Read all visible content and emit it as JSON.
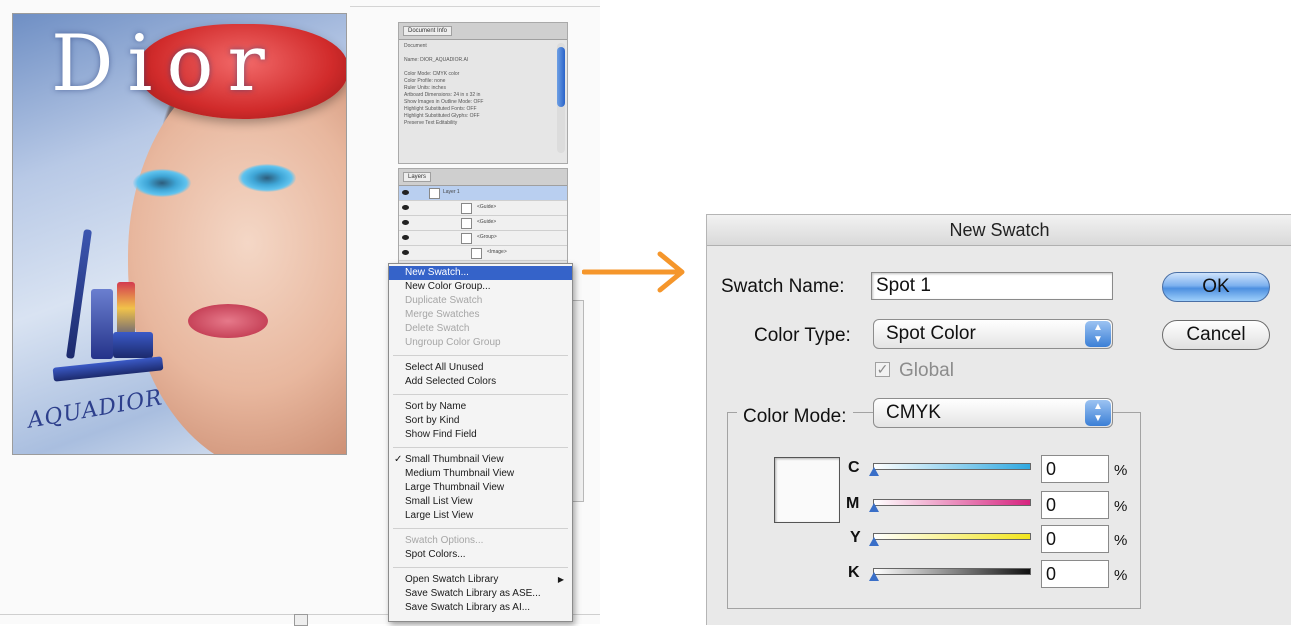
{
  "document": {
    "brand_logo": "Dior",
    "product_name": "AQUADIOR"
  },
  "info_panel": {
    "tab_label": "Document Info",
    "lines": "Document\n\nName: DIOR_AQUADIOR.AI\n\nColor Mode: CMYK color\nColor Profile: none\nRuler Units: inches\nArtboard Dimensions: 24 in x 32 in\nShow Images in Outline Mode: OFF\nHighlight Substituted Fonts: OFF\nHighlight Substituted Glyphs: OFF\nPreserve Text Editability"
  },
  "layers_panel": {
    "tab_label": "Layers",
    "rows": [
      "Layer 1",
      "<Guide>",
      "<Guide>",
      "<Group>",
      "<Image>"
    ]
  },
  "context_menu": {
    "items": [
      {
        "label": "New Swatch...",
        "state": "highlight"
      },
      {
        "label": "New Color Group...",
        "state": "normal"
      },
      {
        "label": "Duplicate Swatch",
        "state": "disabled"
      },
      {
        "label": "Merge Swatches",
        "state": "disabled"
      },
      {
        "label": "Delete Swatch",
        "state": "disabled"
      },
      {
        "label": "Ungroup Color Group",
        "state": "disabled"
      },
      {
        "label": "Select All Unused",
        "state": "normal"
      },
      {
        "label": "Add Selected Colors",
        "state": "normal"
      },
      {
        "label": "Sort by Name",
        "state": "normal"
      },
      {
        "label": "Sort by Kind",
        "state": "normal"
      },
      {
        "label": "Show Find Field",
        "state": "normal"
      },
      {
        "label": "Small Thumbnail View",
        "state": "checked"
      },
      {
        "label": "Medium Thumbnail View",
        "state": "normal"
      },
      {
        "label": "Large Thumbnail View",
        "state": "normal"
      },
      {
        "label": "Small List View",
        "state": "normal"
      },
      {
        "label": "Large List View",
        "state": "normal"
      },
      {
        "label": "Swatch Options...",
        "state": "disabled"
      },
      {
        "label": "Spot Colors...",
        "state": "normal"
      },
      {
        "label": "Open Swatch Library",
        "state": "submenu"
      },
      {
        "label": "Save Swatch Library as ASE...",
        "state": "normal"
      },
      {
        "label": "Save Swatch Library as AI...",
        "state": "normal"
      }
    ]
  },
  "dialog": {
    "title": "New Swatch",
    "swatch_name_label": "Swatch Name:",
    "swatch_name_value": "Spot 1",
    "color_type_label": "Color Type:",
    "color_type_value": "Spot Color",
    "global_label": "Global",
    "color_mode_label": "Color Mode:",
    "color_mode_value": "CMYK",
    "ok_label": "OK",
    "cancel_label": "Cancel",
    "channels": [
      {
        "name": "C",
        "value": "0",
        "unit": "%",
        "color": "#2fa8e0"
      },
      {
        "name": "M",
        "value": "0",
        "unit": "%",
        "color": "#d6247f"
      },
      {
        "name": "Y",
        "value": "0",
        "unit": "%",
        "color": "#f2e51d"
      },
      {
        "name": "K",
        "value": "0",
        "unit": "%",
        "color": "#111111"
      }
    ]
  },
  "colors": {
    "arrow": "#f5962b",
    "menu_highlight": "#3563c9"
  }
}
